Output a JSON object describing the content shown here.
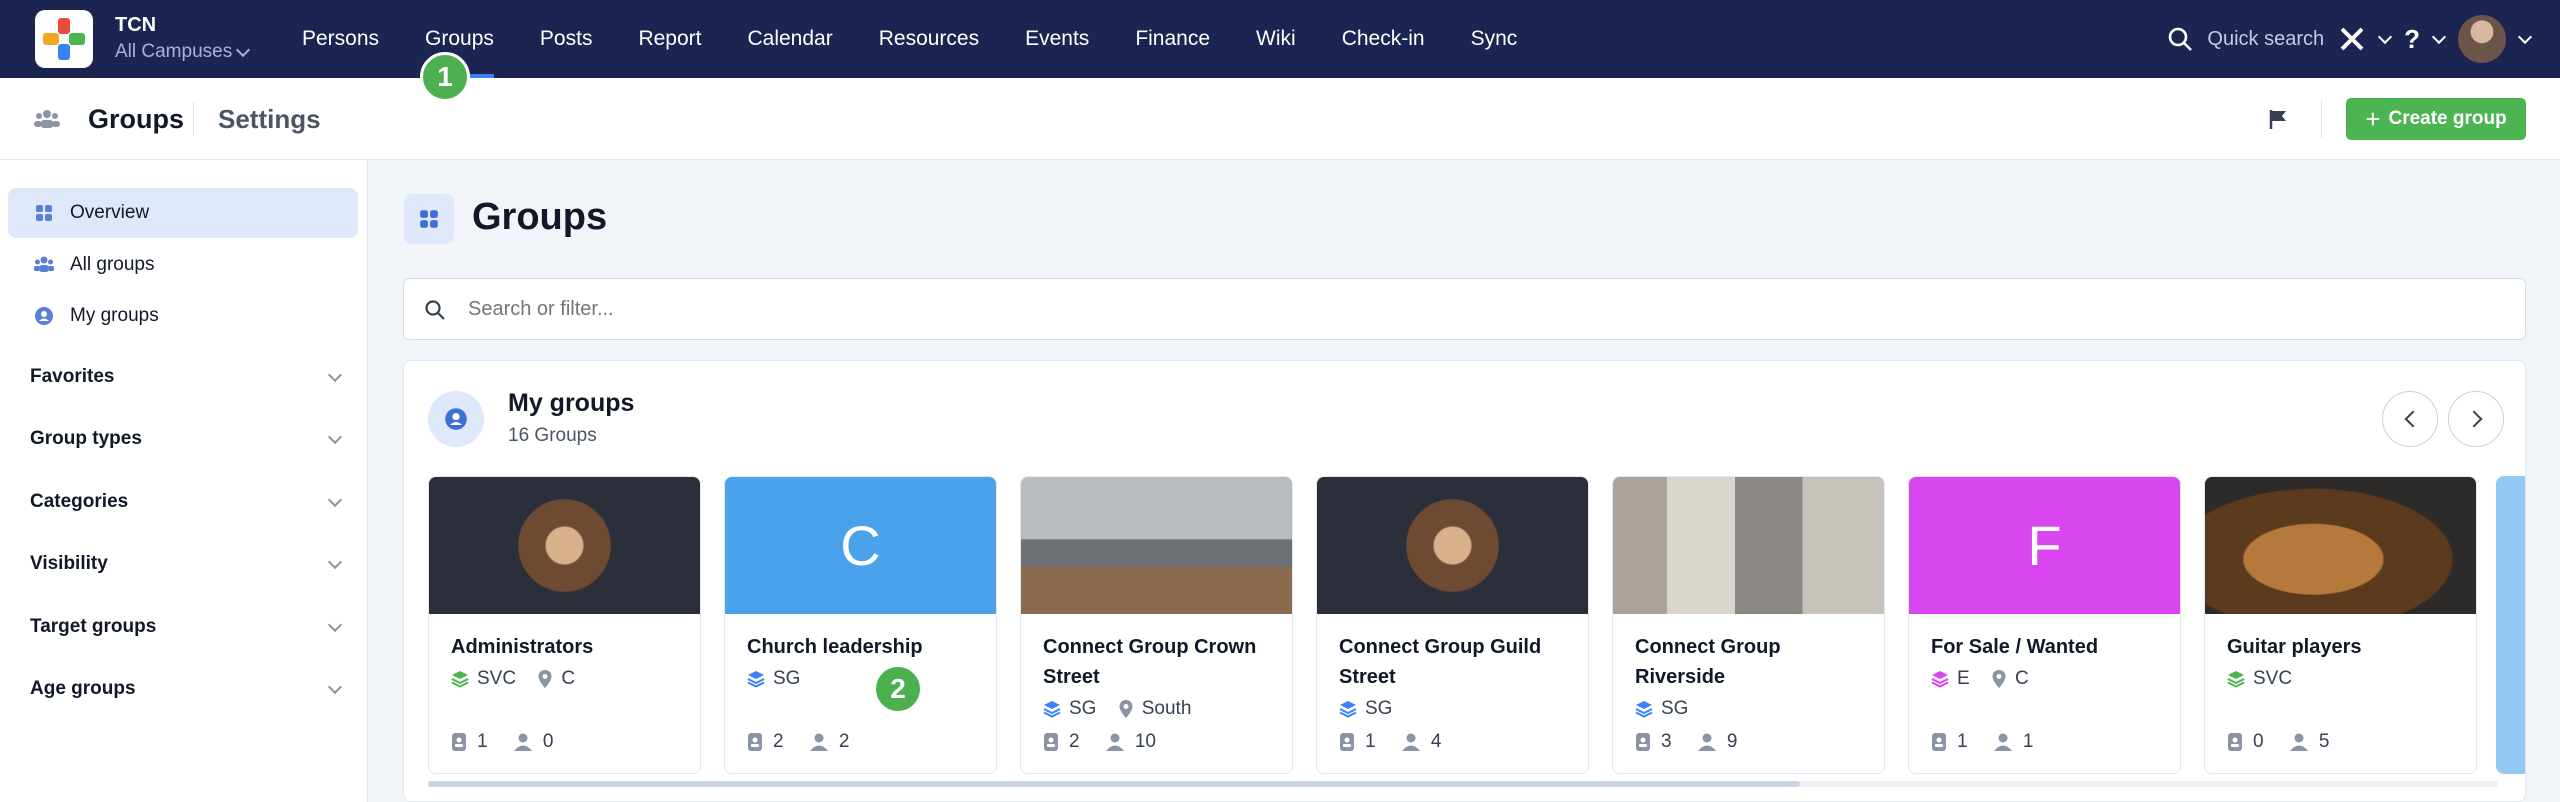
{
  "topnav": {
    "org_name": "TCN",
    "campus": "All Campuses",
    "items": [
      "Persons",
      "Groups",
      "Posts",
      "Report",
      "Calendar",
      "Resources",
      "Events",
      "Finance",
      "Wiki",
      "Check-in",
      "Sync"
    ],
    "active": "Groups",
    "quick_search": "Quick search",
    "help": "?"
  },
  "markers": {
    "m1": "1",
    "m2": "2"
  },
  "subheader": {
    "title": "Groups",
    "settings": "Settings",
    "create_label": "Create group"
  },
  "sidebar": {
    "items": [
      {
        "label": "Overview",
        "icon": "grid-icon"
      },
      {
        "label": "All groups",
        "icon": "users-icon"
      },
      {
        "label": "My groups",
        "icon": "user-circle-icon"
      }
    ],
    "sections": [
      "Favorites",
      "Group types",
      "Categories",
      "Visibility",
      "Target groups",
      "Age groups"
    ]
  },
  "main": {
    "title": "Groups",
    "search_placeholder": "Search or filter...",
    "my_groups": {
      "title": "My groups",
      "count_text": "16 Groups",
      "cards": [
        {
          "name": "Administrators",
          "type": "SVC",
          "type_color": "#4cb552",
          "location": "C",
          "a": "1",
          "b": "0",
          "image": "hands"
        },
        {
          "name": "Church leadership",
          "type": "SG",
          "type_color": "#3b82f6",
          "location": "",
          "a": "2",
          "b": "2",
          "image": "C",
          "image_color": "#4aa3ea"
        },
        {
          "name": "Connect Group Crown Street",
          "type": "SG",
          "type_color": "#3b82f6",
          "location": "South",
          "a": "2",
          "b": "10",
          "image": "sea"
        },
        {
          "name": "Connect Group Guild Street",
          "type": "SG",
          "type_color": "#3b82f6",
          "location": "",
          "a": "1",
          "b": "4",
          "image": "hands"
        },
        {
          "name": "Connect Group Riverside",
          "type": "SG",
          "type_color": "#3b82f6",
          "location": "",
          "a": "3",
          "b": "9",
          "image": "street"
        },
        {
          "name": "For Sale / Wanted",
          "type": "E",
          "type_color": "#d946ef",
          "location": "C",
          "a": "1",
          "b": "1",
          "image": "F",
          "image_color": "#d946ef"
        },
        {
          "name": "Guitar players",
          "type": "SVC",
          "type_color": "#4cb552",
          "location": "",
          "a": "0",
          "b": "5",
          "image": "guitar"
        }
      ]
    }
  }
}
